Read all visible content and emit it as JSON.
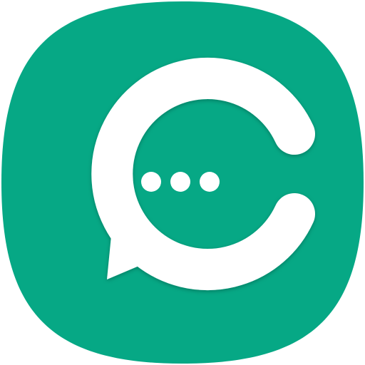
{
  "app_icon": {
    "icon_name": "chat-bubble-c-icon",
    "colors": {
      "background": "#ffffff",
      "tile": "#06a885",
      "glyph": "#ffffff",
      "shadow": "rgba(0,0,0,0.25)"
    },
    "dots_count": 3
  }
}
